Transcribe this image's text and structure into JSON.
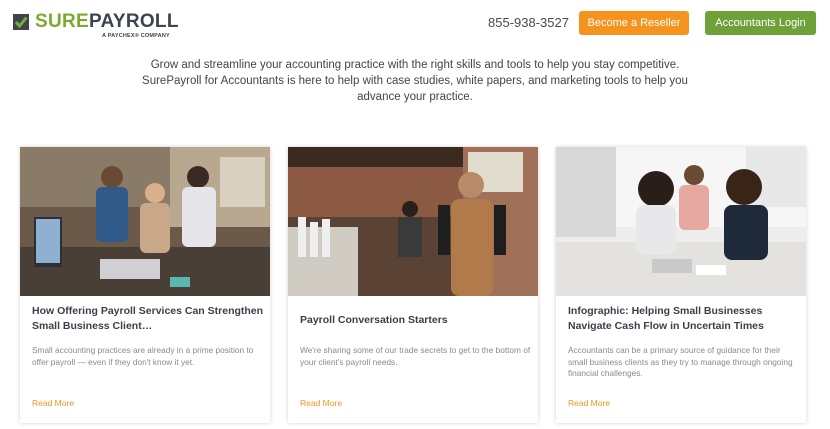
{
  "header": {
    "logo_sure": "SURE",
    "logo_payroll": "PAYROLL",
    "logo_sub": "A PAYCHEX® COMPANY",
    "phone": "855-938-3527",
    "reseller_label": "Become a Reseller",
    "login_label": "Accountants Login"
  },
  "intro": {
    "line1": "Grow and streamline your accounting practice with the right skills and tools to help you stay competitive.",
    "line2": "SurePayroll for Accountants is here to help with case studies, white papers, and marketing tools to help you",
    "line3": "advance your practice."
  },
  "cards": [
    {
      "title": "How Offering Payroll Services Can Strengthen Small Business Client…",
      "description": "Small accounting practices are already in a prime position to offer payroll — even if they don't know it yet.",
      "link": "Read More"
    },
    {
      "title": "Payroll Conversation Starters",
      "description": "We're sharing some of our trade secrets to get to the bottom of your client's payroll needs.",
      "link": "Read More"
    },
    {
      "title": "Infographic: Helping Small Businesses Navigate Cash Flow in Uncertain Times",
      "description": "Accountants can be a primary source of guidance for their small business clients as they try to manage through ongoing financial challenges.",
      "link": "Read More"
    }
  ],
  "colors": {
    "brand_green": "#7aaa2e",
    "brand_dark": "#3d4450",
    "orange": "#f5931f",
    "login_green": "#6ea13a"
  }
}
